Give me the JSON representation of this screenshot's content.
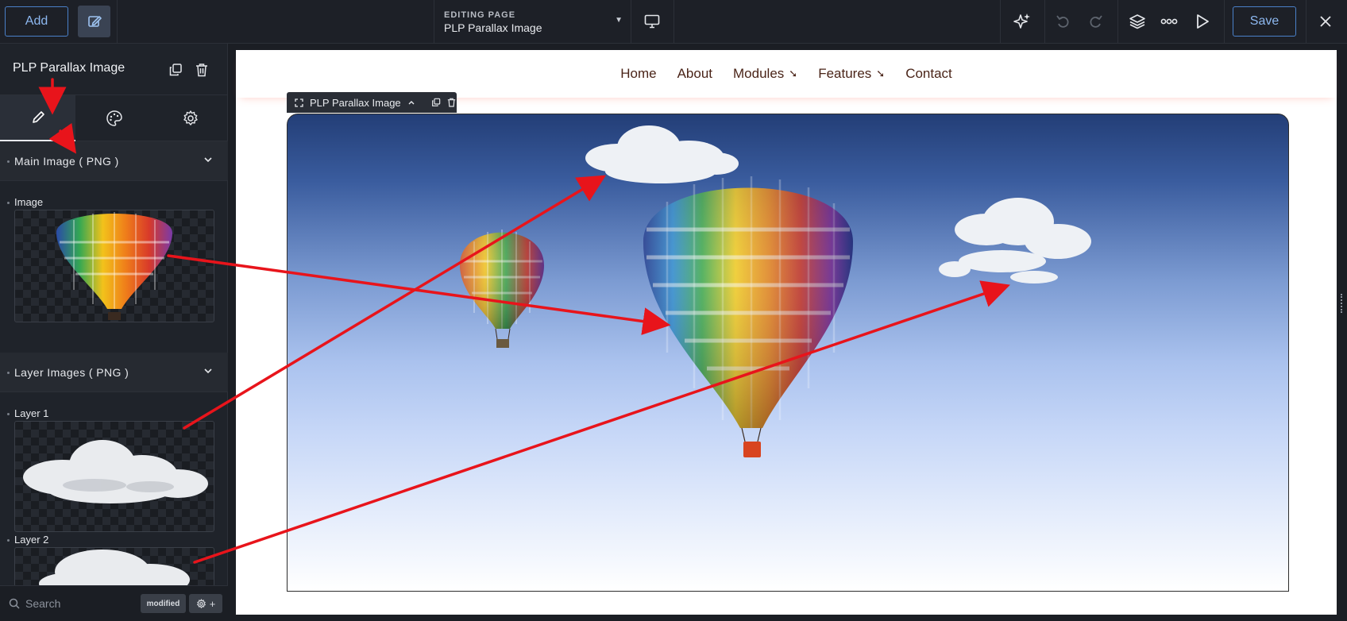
{
  "toolbar": {
    "add_label": "Add",
    "editing_label": "EDITING PAGE",
    "page_name": "PLP Parallax Image",
    "save_label": "Save",
    "icons": [
      "edit-icon",
      "desktop-icon",
      "ai-sparkle-icon",
      "undo-icon",
      "redo-icon",
      "layers-icon",
      "more-icon",
      "play-icon",
      "close-icon"
    ]
  },
  "panel": {
    "title": "PLP Parallax Image",
    "tabs": [
      "content",
      "style",
      "settings"
    ],
    "sections": [
      {
        "title": "Main Image ( PNG )"
      },
      {
        "title": "Layer Images ( PNG )"
      }
    ],
    "fields": {
      "image": "Image",
      "layer1": "Layer 1",
      "layer2": "Layer 2"
    },
    "search_placeholder": "Search",
    "modified_badge": "modified"
  },
  "canvas": {
    "nav": [
      {
        "label": "Home",
        "dropdown": false
      },
      {
        "label": "About",
        "dropdown": false
      },
      {
        "label": "Modules",
        "dropdown": true
      },
      {
        "label": "Features",
        "dropdown": true
      },
      {
        "label": "Contact",
        "dropdown": false
      }
    ],
    "module_tag": "PLP Parallax Image"
  },
  "colors": {
    "accent": "#4a80c9",
    "annotation": "#e8141b",
    "sky_top": "#233e77",
    "nav_text": "#4a2418"
  }
}
